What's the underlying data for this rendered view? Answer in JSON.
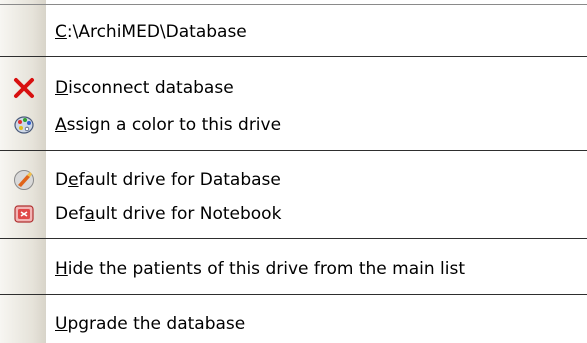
{
  "menu": {
    "items": [
      {
        "pre": "",
        "mn": "C",
        "post": ":\\ArchiMED\\Database",
        "icon": ""
      },
      {
        "pre": "",
        "mn": "D",
        "post": "isconnect database",
        "icon": "red-x-icon"
      },
      {
        "pre": "",
        "mn": "A",
        "post": "ssign a color to this drive",
        "icon": "color-palette-icon"
      },
      {
        "pre": "D",
        "mn": "e",
        "post": "fault drive for Database",
        "icon": "database-brush-icon"
      },
      {
        "pre": "Def",
        "mn": "a",
        "post": "ult drive for Notebook",
        "icon": "notebook-icon"
      },
      {
        "pre": "",
        "mn": "H",
        "post": "ide the patients of this drive from the main list",
        "icon": ""
      },
      {
        "pre": "",
        "mn": "U",
        "post": "pgrade the database",
        "icon": ""
      }
    ]
  },
  "colors": {
    "gutter": "#e6e3da",
    "separator": "#2e2e2e",
    "close_red": "#d81010"
  }
}
